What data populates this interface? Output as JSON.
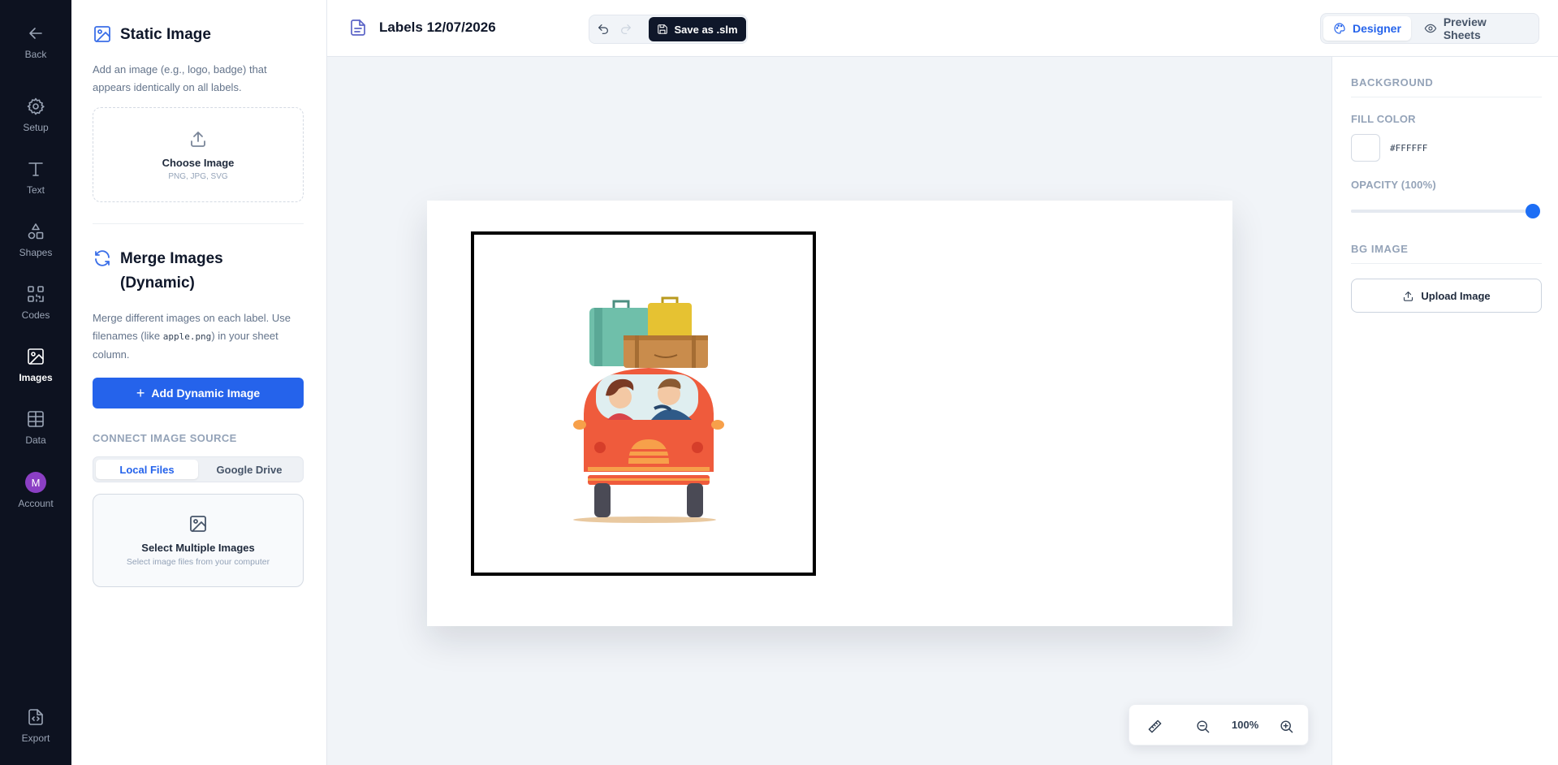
{
  "nav": {
    "back": "Back",
    "items": [
      {
        "label": "Setup",
        "icon": "gear-icon"
      },
      {
        "label": "Text",
        "icon": "text-icon"
      },
      {
        "label": "Shapes",
        "icon": "shapes-icon"
      },
      {
        "label": "Codes",
        "icon": "qr-code-icon"
      },
      {
        "label": "Images",
        "icon": "image-icon",
        "active": true
      },
      {
        "label": "Data",
        "icon": "table-icon"
      }
    ],
    "account": {
      "label": "Account",
      "initial": "M",
      "color": "#8b3fc4"
    },
    "export": "Export"
  },
  "panel": {
    "static": {
      "title": "Static Image",
      "description": "Add an image (e.g., logo, badge) that appears identically on all labels.",
      "choose_title": "Choose Image",
      "choose_formats": "PNG, JPG, SVG"
    },
    "merge": {
      "title": "Merge Images (Dynamic)",
      "desc_before": "Merge different images on each label. Use filenames (like ",
      "desc_code": "apple.png",
      "desc_after": ") in your sheet column.",
      "add_button": "Add Dynamic Image"
    },
    "source": {
      "heading": "CONNECT IMAGE SOURCE",
      "tabs": [
        "Local Files",
        "Google Drive"
      ],
      "active_tab": "Local Files",
      "select_title": "Select Multiple Images",
      "select_sub": "Select image files from your computer"
    }
  },
  "topbar": {
    "doc_title": "Labels 12/07/2026",
    "save_label": "Save as .slm",
    "modes": [
      "Designer",
      "Preview Sheets"
    ],
    "active_mode": "Designer"
  },
  "zoom": {
    "value": "100%"
  },
  "right": {
    "background_heading": "BACKGROUND",
    "fill_heading": "FILL COLOR",
    "fill_hex": "#FFFFFF",
    "opacity_heading": "OPACITY (100%)",
    "opacity": 1.0,
    "bg_image_heading": "BG IMAGE",
    "upload_label": "Upload Image"
  },
  "colors": {
    "accent": "#2563eb",
    "rail": "#0d1220",
    "slider": "#1d6ef5"
  }
}
